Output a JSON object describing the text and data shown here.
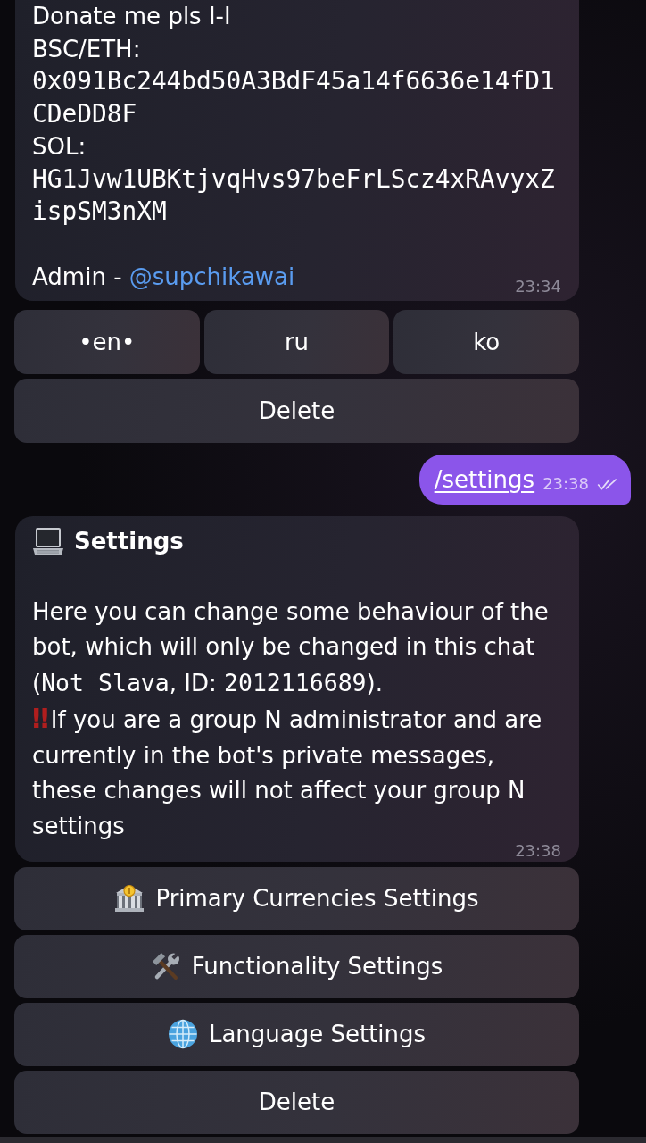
{
  "donation_message": {
    "lines": [
      {
        "kind": "text",
        "text": "Donate me pls I-I"
      },
      {
        "kind": "text",
        "text": "BSC/ETH:"
      },
      {
        "kind": "code",
        "text": "0x091Bc244bd50A3BdF45a14f6636e14fD1CDeDD8F"
      },
      {
        "kind": "text",
        "text": "SOL:"
      },
      {
        "kind": "code",
        "text": "HG1Jvw1UBKtjvqHvs97beFrLScz4xRAvyxZispSM3nXM"
      },
      {
        "kind": "signature",
        "text": "Admin - ",
        "link": "@supchikawai"
      }
    ],
    "time": "23:34",
    "button_rows": [
      [
        {
          "label": "•en•"
        },
        {
          "label": "ru"
        },
        {
          "label": "ko"
        }
      ],
      [
        {
          "label": "Delete"
        }
      ]
    ]
  },
  "command_message": {
    "text": "/settings",
    "time": "23:38",
    "read": true
  },
  "settings_message": {
    "title": "Settings",
    "paragraphs": [
      {
        "segments": [
          {
            "kind": "text",
            "text": "Here you can change some behaviour of the bot, which will only be changed in this chat ("
          },
          {
            "kind": "code",
            "text": "Not Slava"
          },
          {
            "kind": "text",
            "text": ", ID: "
          },
          {
            "kind": "code",
            "text": "2012116689"
          },
          {
            "kind": "text",
            "text": ")."
          }
        ]
      },
      {
        "segments": [
          {
            "kind": "emoji",
            "text": "‼"
          },
          {
            "kind": "text",
            "text": "If you are a group N administrator and are currently in the bot's private messages, these changes will not affect your group N settings"
          }
        ]
      }
    ],
    "time": "23:38",
    "buttons": [
      {
        "label": "Primary Currencies Settings"
      },
      {
        "label": "Functionality Settings"
      },
      {
        "label": "Language Settings"
      },
      {
        "label": "Delete"
      }
    ]
  }
}
